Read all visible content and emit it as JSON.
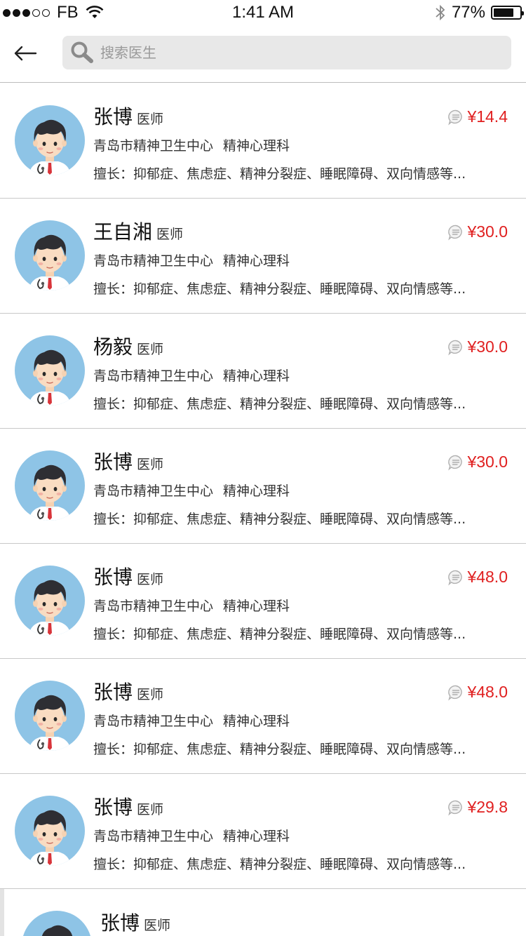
{
  "status_bar": {
    "carrier": "FB",
    "time": "1:41 AM",
    "battery_text": "77%",
    "battery_level": 0.77
  },
  "header": {
    "back_icon": "arrow-left-icon",
    "search_icon": "search-icon",
    "search_placeholder": "搜索医生"
  },
  "colors": {
    "price": "#e02020",
    "avatar_bg": "#8ec4e6",
    "divider": "#c8c8c8",
    "search_bg": "#e8e8e8"
  },
  "doctors": [
    {
      "name": "张博",
      "title": "医师",
      "hospital": "青岛市精神卫生中心",
      "department": "精神心理科",
      "skill": "擅长：抑郁症、焦虑症、精神分裂症、睡眠障碍、双向情感等...",
      "price": "¥14.4"
    },
    {
      "name": "王自湘",
      "title": "医师",
      "hospital": "青岛市精神卫生中心",
      "department": "精神心理科",
      "skill": "擅长：抑郁症、焦虑症、精神分裂症、睡眠障碍、双向情感等...",
      "price": "¥30.0"
    },
    {
      "name": "杨毅",
      "title": "医师",
      "hospital": "青岛市精神卫生中心",
      "department": "精神心理科",
      "skill": "擅长：抑郁症、焦虑症、精神分裂症、睡眠障碍、双向情感等...",
      "price": "¥30.0"
    },
    {
      "name": "张博",
      "title": "医师",
      "hospital": "青岛市精神卫生中心",
      "department": "精神心理科",
      "skill": "擅长：抑郁症、焦虑症、精神分裂症、睡眠障碍、双向情感等...",
      "price": "¥30.0"
    },
    {
      "name": "张博",
      "title": "医师",
      "hospital": "青岛市精神卫生中心",
      "department": "精神心理科",
      "skill": "擅长：抑郁症、焦虑症、精神分裂症、睡眠障碍、双向情感等...",
      "price": "¥48.0"
    },
    {
      "name": "张博",
      "title": "医师",
      "hospital": "青岛市精神卫生中心",
      "department": "精神心理科",
      "skill": "擅长：抑郁症、焦虑症、精神分裂症、睡眠障碍、双向情感等...",
      "price": "¥48.0"
    },
    {
      "name": "张博",
      "title": "医师",
      "hospital": "青岛市精神卫生中心",
      "department": "精神心理科",
      "skill": "擅长：抑郁症、焦虑症、精神分裂症、睡眠障碍、双向情感等...",
      "price": "¥29.8"
    },
    {
      "name": "张博",
      "title": "医师"
    }
  ]
}
